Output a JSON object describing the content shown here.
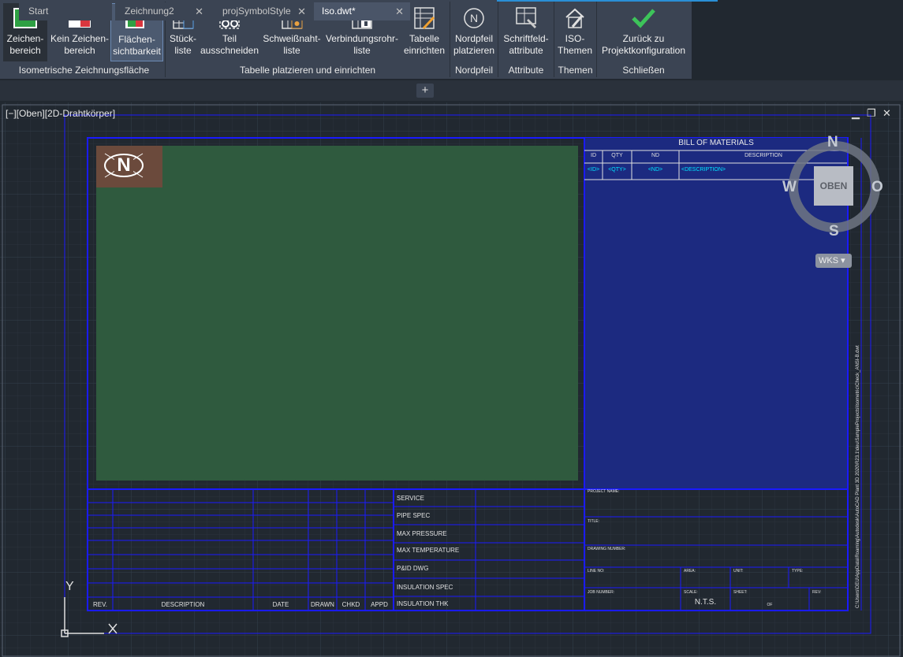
{
  "ribbon": {
    "buttons": [
      {
        "line1": "Zeichen-",
        "line2": "bereich"
      },
      {
        "line1": "Kein Zeichen-",
        "line2": "bereich"
      },
      {
        "line1": "Flächen-",
        "line2": "sichtbarkeit"
      },
      {
        "line1": "Stück-",
        "line2": "liste"
      },
      {
        "line1": "Teil",
        "line2": "ausschneiden"
      },
      {
        "line1": "Schweißnaht-",
        "line2": "liste"
      },
      {
        "line1": "Verbindungsrohr-",
        "line2": "liste"
      },
      {
        "line1": "Tabelle",
        "line2": "einrichten"
      },
      {
        "line1": "Nordpfeil",
        "line2": "platzieren"
      },
      {
        "line1": "Schriftfeld-",
        "line2": "attribute"
      },
      {
        "line1": "ISO-",
        "line2": "Themen"
      },
      {
        "line1": "Zurück zu",
        "line2": "Projektkonfiguration"
      }
    ],
    "groups": [
      "Isometrische Zeichnungsfläche",
      "Tabelle platzieren und einrichten",
      "Nordpfeil",
      "Attribute",
      "Themen",
      "Schließen"
    ]
  },
  "tabs": [
    {
      "label": "Start",
      "closable": false
    },
    {
      "label": "Zeichnung2",
      "closable": true
    },
    {
      "label": "projSymbolStyle",
      "closable": true
    },
    {
      "label": "Iso.dwt*",
      "closable": true,
      "active": true
    }
  ],
  "tab_close_glyph": "✕",
  "new_tab_glyph": "+",
  "viewport": {
    "label": "[−][Oben][2D-Drahtkörper]",
    "controls": [
      "▁",
      "❐",
      "✕"
    ]
  },
  "navigation": {
    "north": "N",
    "south": "S",
    "west": "W",
    "east": "O",
    "viewcube_face": "OBEN",
    "ucs_menu": "WKS ▾",
    "ucs_y": "Y"
  },
  "north_arrow_letter": "N",
  "bom": {
    "title": "BILL OF MATERIALS",
    "headers": [
      "ID",
      "QTY",
      "ND",
      "DESCRIPTION"
    ],
    "row": [
      "<ID>",
      "<QTY>",
      "<ND>",
      "<DESCRIPTION>"
    ]
  },
  "revision_headers": [
    "REV.",
    "DESCRIPTION",
    "DATE",
    "DRAWN",
    "CHKD",
    "APPD"
  ],
  "specs": [
    "SERVICE",
    "PIPE SPEC",
    "MAX PRESSURE",
    "MAX TEMPERATURE",
    "P&ID DWG",
    "INSULATION SPEC",
    "INSULATION THK"
  ],
  "titleblock": {
    "project_name": "PROJECT NAME:",
    "title": "TITLE:",
    "drawing_number": "DRAWING NUMBER:",
    "line_no": "LINE NO:",
    "area": "AREA:",
    "unit": "UNIT:",
    "type": "TYPE:",
    "job_number": "JOB NUMBER:",
    "scale": "SCALE:",
    "scale_value": "N.T.S.",
    "sheet": "SHEET:",
    "of": "OF",
    "rev": "REV:"
  },
  "file_path": "C:\\Users\\DEU\\AppData\\Roaming\\Autodesk\\AutoCAD Plant 3D 2020\\R23.1\\deu\\SampleProjects\\Isometric\\Check_ANSI-B.dwt",
  "colors": {
    "ribbon_bg": "#3b4453",
    "canvas_bg": "#212830",
    "border_blue": "#1a1aff",
    "drawing_area": "#2e5a3f",
    "bom_fill": "#1c2a80",
    "cyan_text": "#00e5ff"
  }
}
